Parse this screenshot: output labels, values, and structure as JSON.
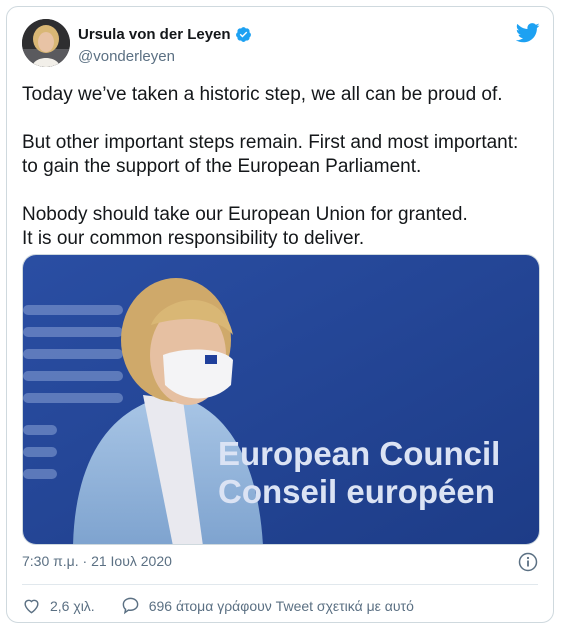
{
  "tweet": {
    "author_name": "Ursula von der Leyen",
    "author_handle": "@vonderleyen",
    "paragraphs": [
      [
        "Today we’ve taken a historic step, we all can be proud of."
      ],
      [
        "But other important steps remain. First and most important:",
        "to gain the support of the European Parliament."
      ],
      [
        "Nobody should take our European Union for granted.",
        "It is our common responsibility to deliver."
      ]
    ],
    "image_text_line1": "European Council",
    "image_text_line2": "Conseil européen",
    "timestamp": "7:30 π.μ. · 21 Ιουλ 2020",
    "likes": "2,6 χιλ.",
    "replies_label": "696 άτομα γράφουν Tweet σχετικά με αυτό"
  },
  "colors": {
    "brand": "#1da1f2",
    "text": "#14171a",
    "secondary": "#5b7083",
    "photo_bg": "#24479a"
  },
  "icons": [
    "verified-badge-icon",
    "twitter-bird-icon",
    "info-icon",
    "heart-icon",
    "reply-icon"
  ]
}
